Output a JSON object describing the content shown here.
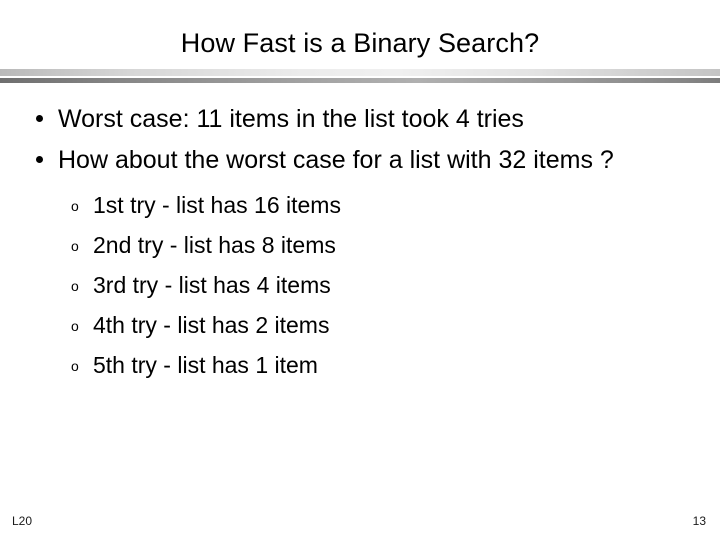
{
  "slide": {
    "title": "How Fast is a Binary Search?",
    "bullet_marker": "•",
    "sub_marker": "o",
    "bullets": [
      {
        "text": "Worst case: 11 items in the list took 4 tries"
      },
      {
        "text": "How about the worst case for a list with 32 items ?"
      }
    ],
    "sub_bullets": [
      {
        "text": "1st try - list has 16 items"
      },
      {
        "text": "2nd try - list has 8 items"
      },
      {
        "text": "3rd try - list has 4 items"
      },
      {
        "text": "4th try - list has 2 items"
      },
      {
        "text": "5th try - list has 1 item"
      }
    ],
    "footer": {
      "left_label": "L20",
      "page_number": "13"
    },
    "colors": {
      "text": "#000000",
      "background": "#ffffff",
      "divider_light": "#f0f0f0",
      "divider_dark": "#7c7c7c"
    }
  }
}
